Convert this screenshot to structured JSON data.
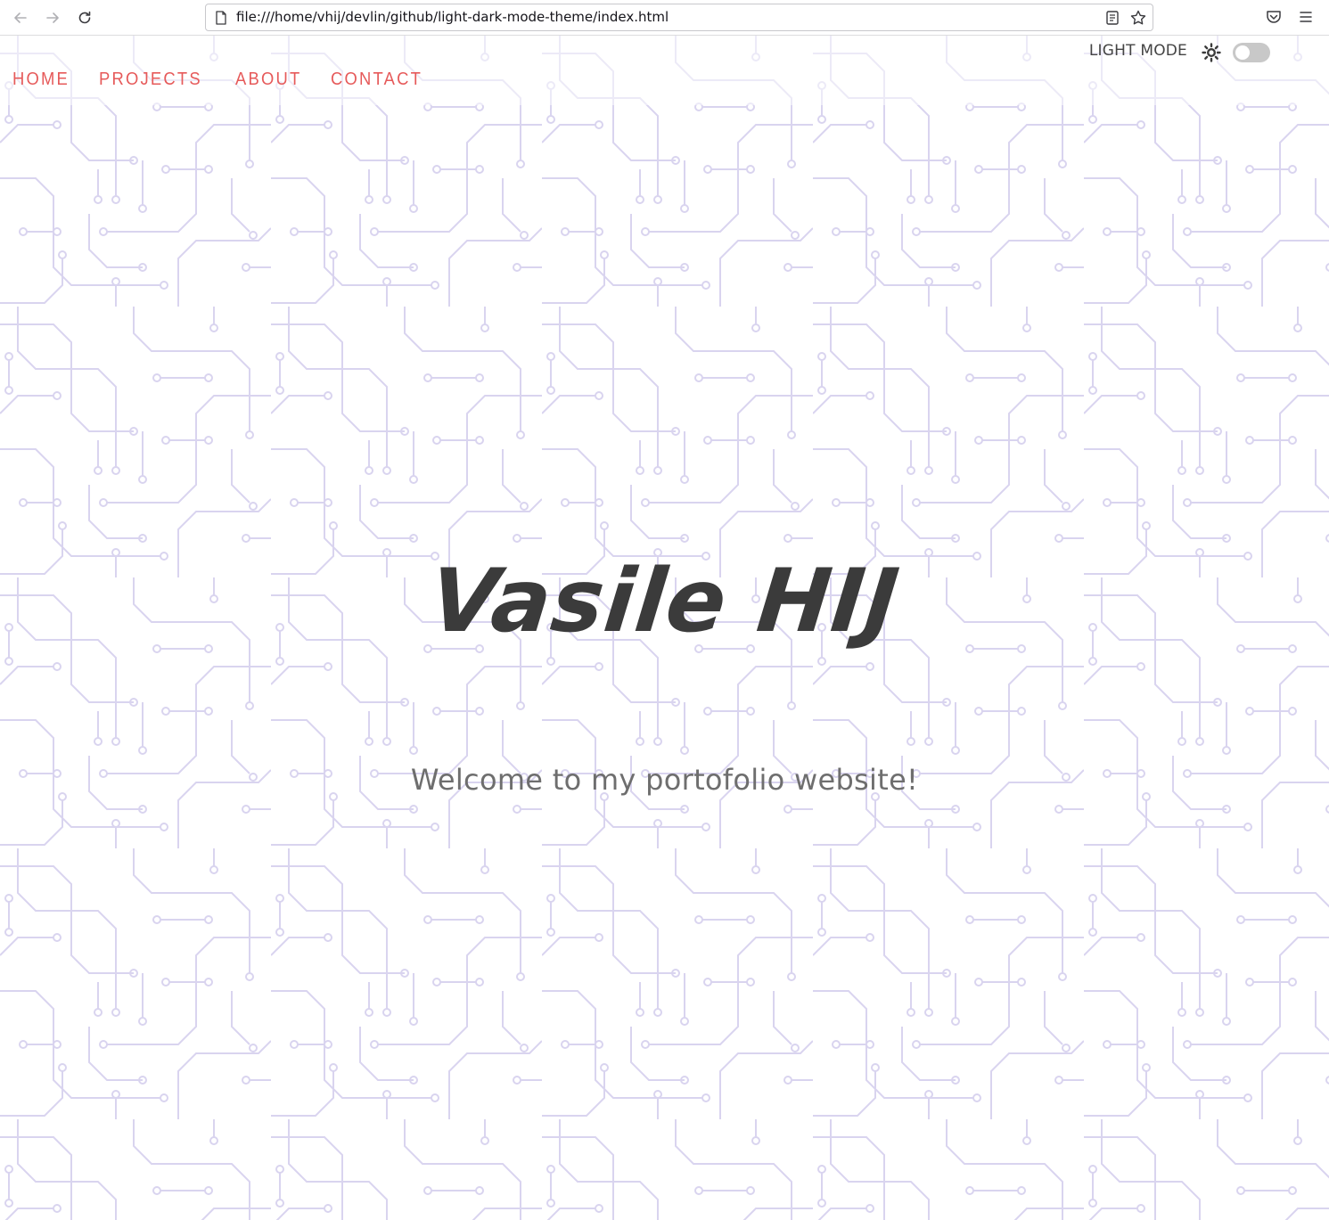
{
  "browser": {
    "url": "file:///home/vhij/devlin/github/light-dark-mode-theme/index.html",
    "icons": {
      "back": "back-arrow-icon",
      "forward": "forward-arrow-icon",
      "reload": "reload-icon",
      "page": "page-icon",
      "reader": "reader-view-icon",
      "bookmark": "star-icon",
      "pocket": "pocket-icon",
      "menu": "hamburger-menu-icon"
    }
  },
  "nav": {
    "links": [
      "HOME",
      "PROJECTS",
      "ABOUT",
      "CONTACT"
    ]
  },
  "theme_switch": {
    "label": "LIGHT MODE",
    "icon": "sun-icon",
    "checked": false
  },
  "hero": {
    "title": "Vasile HIJ",
    "subtitle": "Welcome to my portofolio website!"
  },
  "colors": {
    "nav_link": "#e65a5a",
    "title": "#3b3b3b",
    "subtitle": "#6e6e6e",
    "pattern": "#d9d4ef",
    "toggle_track": "#c8c8c8"
  }
}
